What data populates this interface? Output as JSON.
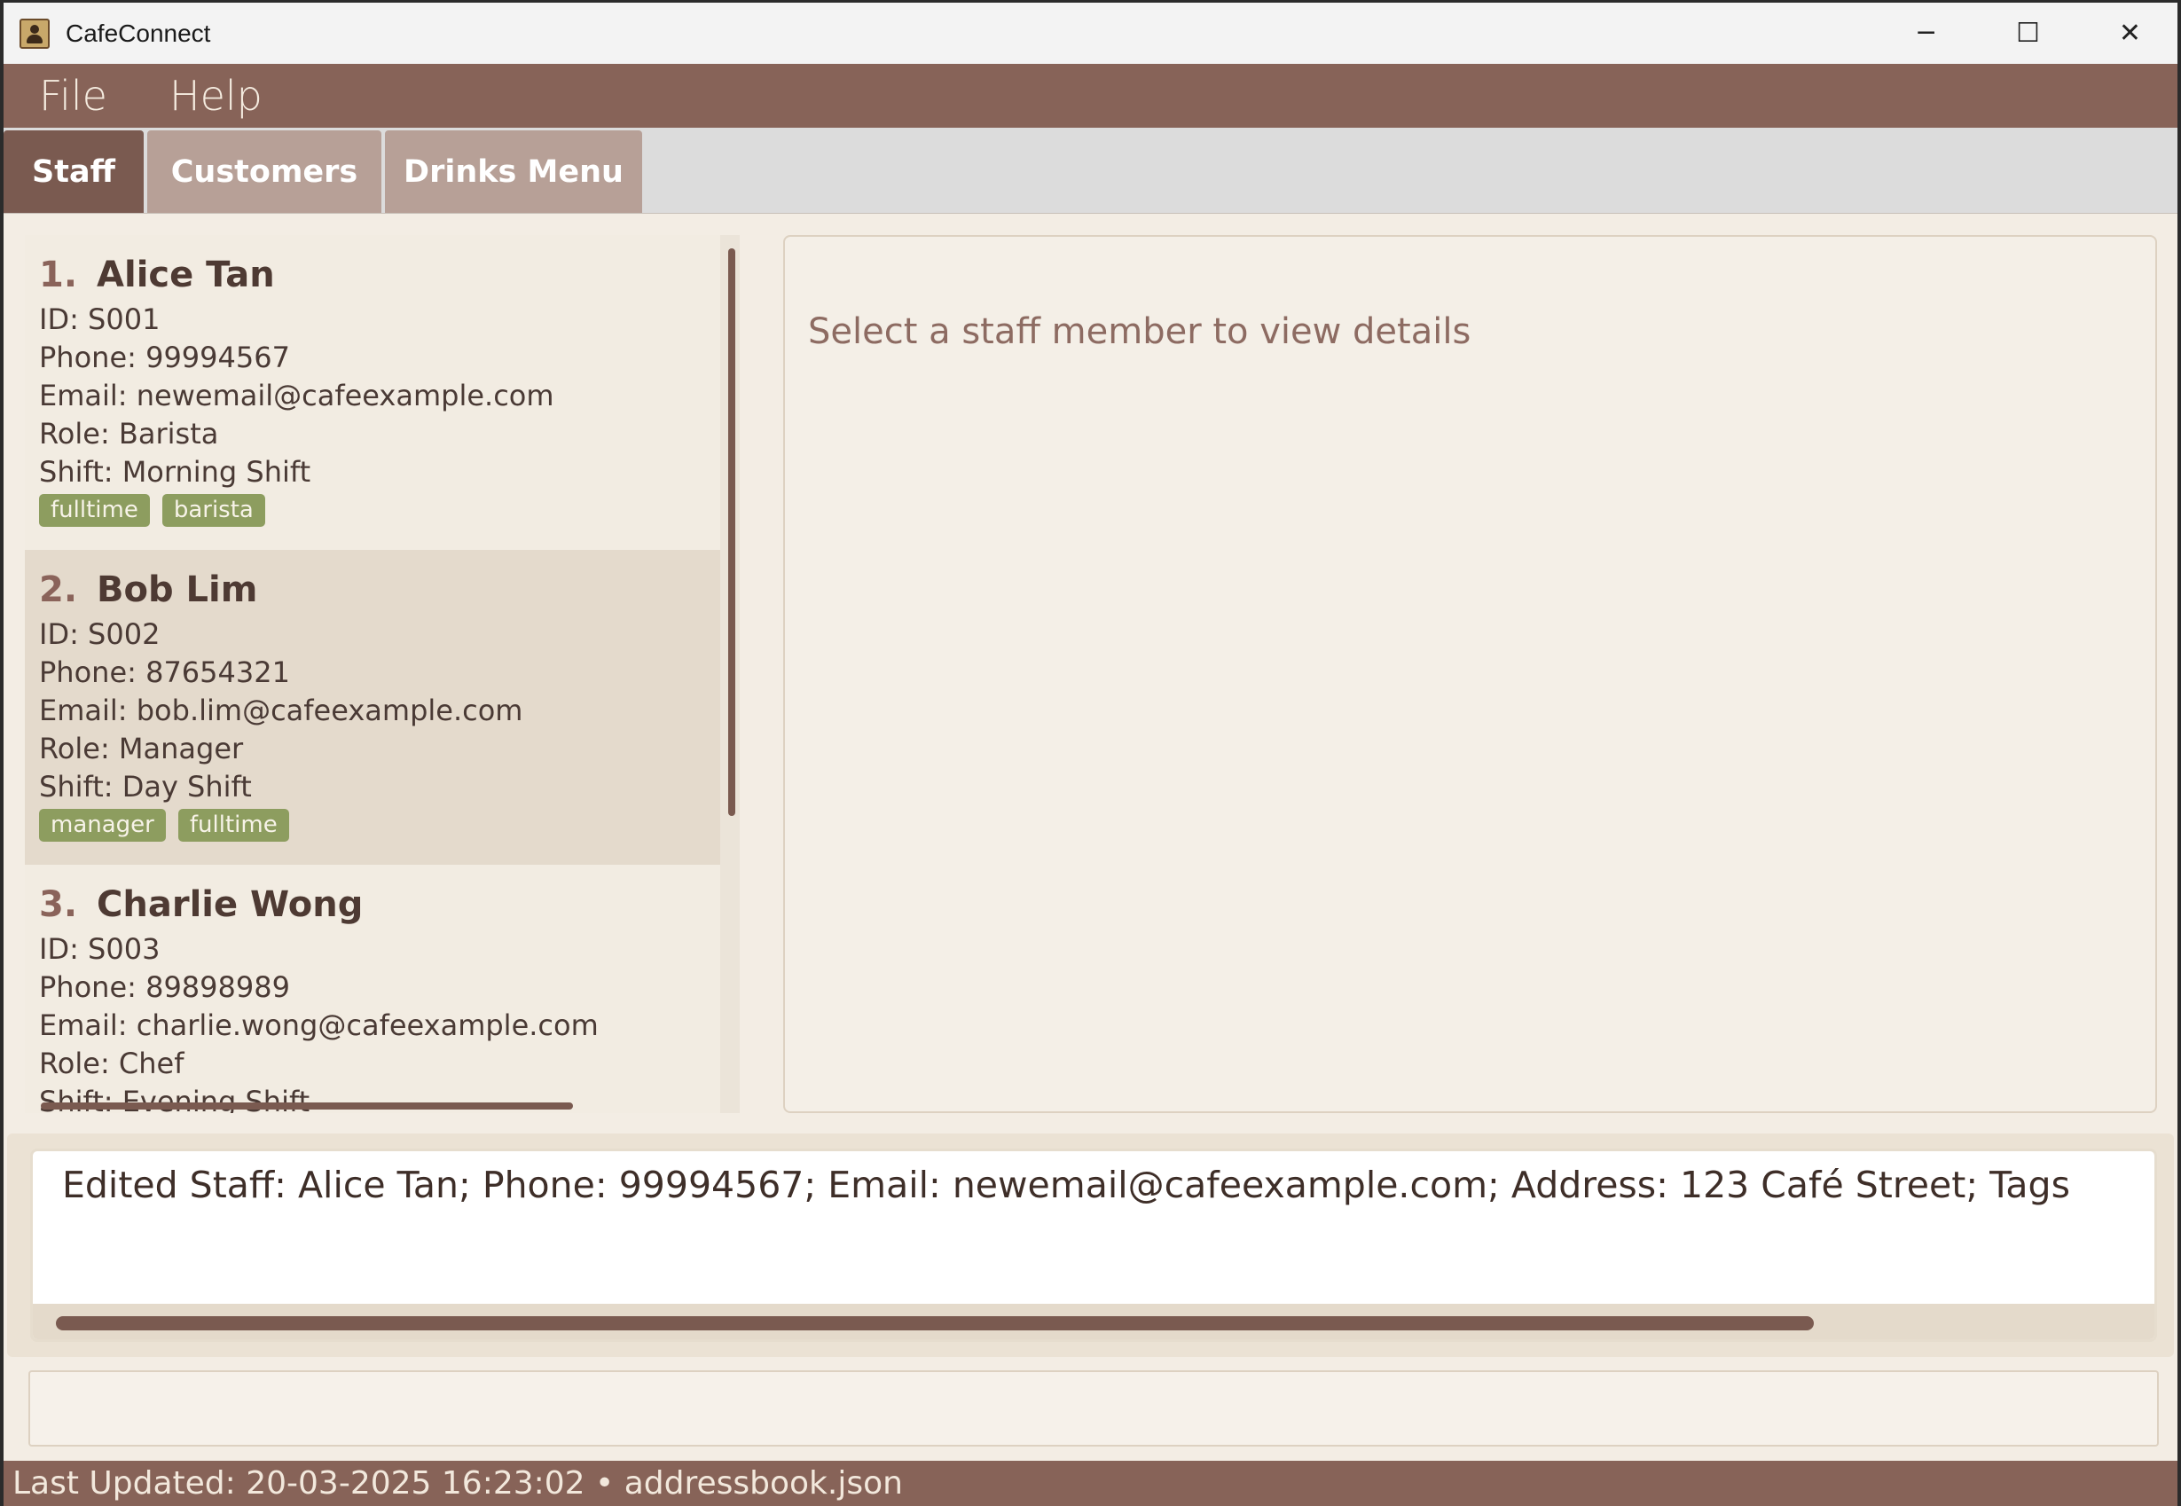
{
  "window": {
    "title": "CafeConnect",
    "minimize_glyph": "─",
    "maximize_glyph": "☐",
    "close_glyph": "✕"
  },
  "menubar": {
    "file": "File",
    "help": "Help"
  },
  "tabs": [
    {
      "label": "Staff",
      "active": true
    },
    {
      "label": "Customers",
      "active": false
    },
    {
      "label": "Drinks Menu",
      "active": false
    }
  ],
  "staff_list": [
    {
      "index": "1.",
      "name": "Alice Tan",
      "id": "ID: S001",
      "phone": "Phone: 99994567",
      "email": "Email: newemail@cafeexample.com",
      "role": "Role: Barista",
      "shift": "Shift: Morning Shift",
      "tags": [
        "fulltime",
        "barista"
      ]
    },
    {
      "index": "2.",
      "name": "Bob Lim",
      "id": "ID: S002",
      "phone": "Phone: 87654321",
      "email": "Email: bob.lim@cafeexample.com",
      "role": "Role: Manager",
      "shift": "Shift: Day Shift",
      "tags": [
        "manager",
        "fulltime"
      ]
    },
    {
      "index": "3.",
      "name": "Charlie Wong",
      "id": "ID: S003",
      "phone": "Phone: 89898989",
      "email": "Email: charlie.wong@cafeexample.com",
      "role": "Role: Chef",
      "shift": "Shift: Evening Shift",
      "tags": []
    }
  ],
  "detail": {
    "prompt": "Select a staff member to view details"
  },
  "result": {
    "text": "Edited Staff: Alice Tan; Phone: 99994567; Email: newemail@cafeexample.com; Address: 123 Café Street; Tags"
  },
  "command": {
    "value": ""
  },
  "status": {
    "text": "Last Updated: 20-03-2025 16:23:02 • addressbook.json"
  },
  "colors": {
    "accent": "#876358",
    "tab_active": "#7a5a50",
    "tab_inactive": "#b7a097",
    "tag": "#8d9d5f",
    "background": "#f3ede4"
  }
}
